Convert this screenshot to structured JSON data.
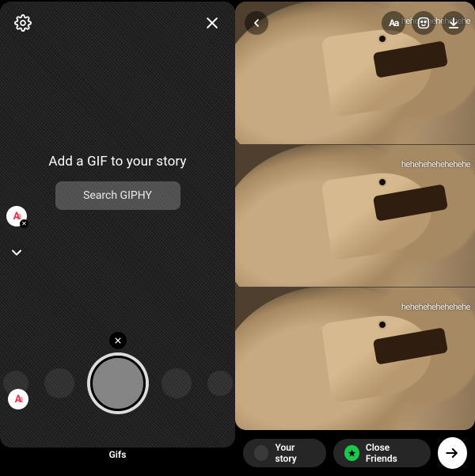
{
  "left": {
    "title": "Add a GIF to your story",
    "search_label": "Search GIPHY",
    "footer_mode": "Gifs"
  },
  "right": {
    "overlay_text": "hehehehehehehehe",
    "your_story_label": "Your story",
    "close_friends_label": "Close Friends"
  }
}
